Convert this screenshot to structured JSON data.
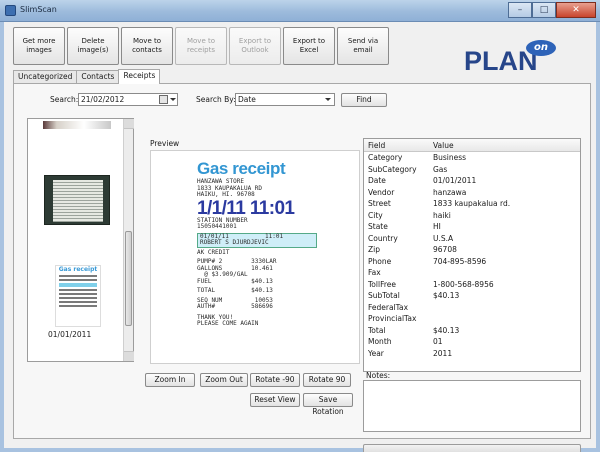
{
  "window": {
    "title": "SlimScan"
  },
  "toolbar": {
    "buttons": [
      {
        "label": "Get more images",
        "enabled": true
      },
      {
        "label": "Delete image(s)",
        "enabled": true
      },
      {
        "label": "Move to contacts",
        "enabled": true
      },
      {
        "label": "Move to receipts",
        "enabled": false
      },
      {
        "label": "Export to Outlook",
        "enabled": false
      },
      {
        "label": "Export to Excel",
        "enabled": true
      },
      {
        "label": "Send via email",
        "enabled": true
      }
    ]
  },
  "logo": {
    "text": "PLAN",
    "badge": "on"
  },
  "tabs": [
    "Uncategorized",
    "Contacts",
    "Receipts"
  ],
  "active_tab": "Receipts",
  "search": {
    "label": "Search:",
    "date_value": "21/02/2012",
    "by_label": "Search By:",
    "by_value": "Date",
    "find_label": "Find"
  },
  "thumbnails": {
    "selected_date": "01/01/2011",
    "receipt_title": "Gas receipt"
  },
  "preview": {
    "label": "Preview",
    "receipt": {
      "title": "Gas receipt",
      "store": "HANZAWA STORE",
      "address1": "1833 KAUPAKALUA RD",
      "address2": "HAIKU, HI. 96708",
      "datetime": "1/1/11  11:01",
      "station_label": "STATION NUMBER",
      "station_number": "15050441001",
      "card_line1": "01/01/11          11:01",
      "card_line2": "ROBERT S DJURDJEVIC",
      "card_line3": "AK CREDIT",
      "pump": "PUMP# 2        3330LAR",
      "gallons": "GALLONS        10.461",
      "price": "  @ $3.909/GAL",
      "fuel": "FUEL           $40.13",
      "total": "TOTAL          $40.13",
      "seq": "SEQ NUM         10053",
      "auth": "AUTH#          586696",
      "thanks": "THANK YOU!",
      "again": "PLEASE COME AGAIN"
    },
    "buttons": {
      "zoom_in": "Zoom In",
      "zoom_out": "Zoom Out",
      "rotate_left": "Rotate -90",
      "rotate_right": "Rotate 90",
      "reset_view": "Reset View",
      "save_rotation": "Save Rotation"
    }
  },
  "fields": {
    "headers": [
      "Field",
      "Value"
    ],
    "rows": [
      [
        "Category",
        "Business"
      ],
      [
        "SubCategory",
        "Gas"
      ],
      [
        "Date",
        "01/01/2011"
      ],
      [
        "Vendor",
        "hanzawa"
      ],
      [
        "Street",
        "1833 kaupakalua rd."
      ],
      [
        "City",
        "haiki"
      ],
      [
        "State",
        "HI"
      ],
      [
        "Country",
        "U.S.A"
      ],
      [
        "Zip",
        "96708"
      ],
      [
        "Phone",
        "704-895-8596"
      ],
      [
        "Fax",
        ""
      ],
      [
        "TollFree",
        "1-800-568-8956"
      ],
      [
        "SubTotal",
        "$40.13"
      ],
      [
        "FederalTax",
        ""
      ],
      [
        "ProvincialTax",
        ""
      ],
      [
        "Total",
        "$40.13"
      ],
      [
        "Month",
        "01"
      ],
      [
        "Year",
        "2011"
      ]
    ]
  },
  "notes": {
    "label": "Notes:",
    "value": ""
  }
}
